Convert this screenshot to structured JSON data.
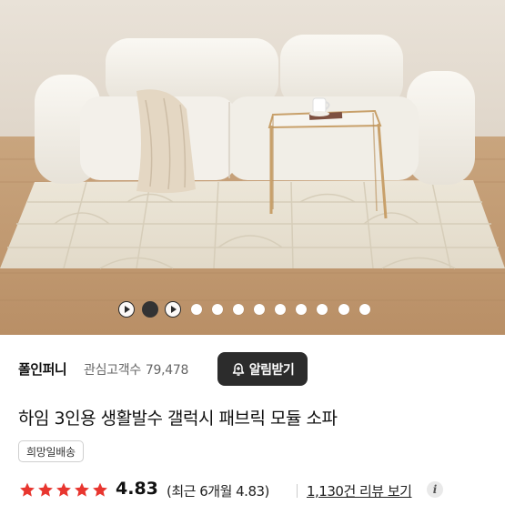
{
  "gallery": {
    "image_subject": "sofa-and-rug-photo",
    "indicators": [
      {
        "type": "play"
      },
      {
        "type": "active"
      },
      {
        "type": "play"
      },
      {
        "type": "inactive"
      },
      {
        "type": "inactive"
      },
      {
        "type": "inactive"
      },
      {
        "type": "inactive"
      },
      {
        "type": "inactive"
      },
      {
        "type": "inactive"
      },
      {
        "type": "inactive"
      },
      {
        "type": "inactive"
      },
      {
        "type": "inactive"
      }
    ]
  },
  "store": {
    "name": "폴인퍼니",
    "fans_label": "관심고객수",
    "fans_count": "79,478",
    "alarm_button_label": "알림받기",
    "alarm_icon": "bell-plus-icon"
  },
  "product": {
    "title": "하임 3인용 생활발수 갤럭시 패브릭 모듈 소파",
    "badge": "희망일배송"
  },
  "rating": {
    "stars": 5,
    "star_color": "#e8362f",
    "score": "4.83",
    "recent_text": "(최근 6개월 4.83)",
    "reviews_link": "1,130건 리뷰 보기",
    "info_icon": "info-icon"
  },
  "colors": {
    "button_bg": "#2c2c2c",
    "star": "#e8362f"
  }
}
